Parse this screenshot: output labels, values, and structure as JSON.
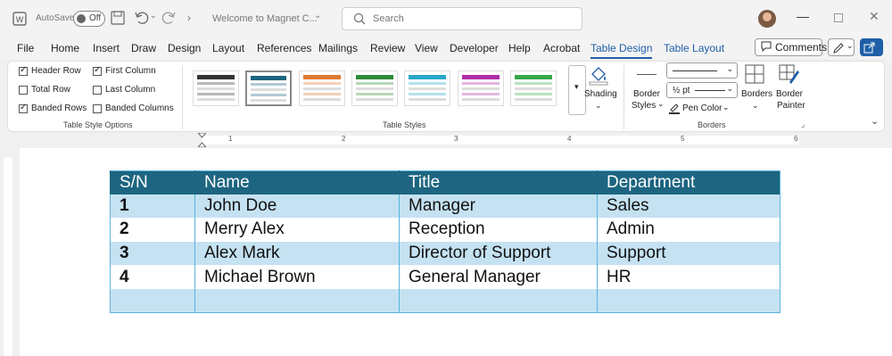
{
  "titlebar": {
    "autosave_label": "AutoSave",
    "autosave_state": "Off",
    "doc_title": "Welcome to Magnet C...",
    "search_placeholder": "Search"
  },
  "menu": {
    "tabs": [
      "File",
      "Home",
      "Insert",
      "Draw",
      "Design",
      "Layout",
      "References",
      "Mailings",
      "Review",
      "View",
      "Developer",
      "Help",
      "Acrobat",
      "Table Design",
      "Table Layout"
    ],
    "active_tab": "Table Design",
    "comments_label": "Comments"
  },
  "ribbon": {
    "style_options": {
      "header_row": "Header Row",
      "first_column": "First Column",
      "total_row": "Total Row",
      "last_column": "Last Column",
      "banded_rows": "Banded Rows",
      "banded_columns": "Banded Columns",
      "checked": {
        "header_row": true,
        "first_column": true,
        "total_row": false,
        "last_column": false,
        "banded_rows": true,
        "banded_columns": false
      },
      "group_label": "Table Style Options"
    },
    "table_styles": {
      "group_label": "Table Styles",
      "colors": [
        "#333333",
        "#1d6580",
        "#e07a30",
        "#2e8b3a",
        "#2aa6c9",
        "#b02ea8",
        "#38a84a"
      ]
    },
    "shading_label": "Shading",
    "border_styles_label": "Border\nStyles",
    "border_styles_l1": "Border",
    "border_styles_l2": "Styles",
    "pen_weight": "½ pt",
    "pen_color_label": "Pen Color",
    "borders_label": "Borders",
    "border_painter_l1": "Border",
    "border_painter_l2": "Painter",
    "borders_group_label": "Borders"
  },
  "ruler": [
    "1",
    "2",
    "3",
    "4",
    "5",
    "6"
  ],
  "table": {
    "headers": [
      "S/N",
      "Name",
      "Title",
      "Department"
    ],
    "rows": [
      [
        "1",
        "John Doe",
        "Manager",
        "Sales"
      ],
      [
        "2",
        "Merry Alex",
        "Reception",
        "Admin"
      ],
      [
        "3",
        "Alex Mark",
        "Director of Support",
        "Support"
      ],
      [
        "4",
        "Michael Brown",
        "General Manager",
        "HR"
      ],
      [
        "",
        "",
        "",
        ""
      ]
    ]
  }
}
